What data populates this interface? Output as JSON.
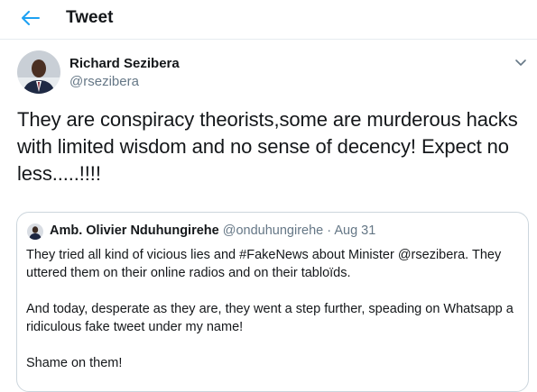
{
  "header": {
    "title": "Tweet"
  },
  "tweet": {
    "author_name": "Richard Sezibera",
    "author_handle": "@rsezibera",
    "text": "They are conspiracy theorists,some are murderous hacks with limited wisdom and no sense of decency! Expect no less.....!!!!"
  },
  "quoted_tweet": {
    "author_name": "Amb. Olivier Nduhungirehe",
    "author_handle": "@onduhungirehe",
    "separator": "·",
    "date": "Aug 31",
    "paragraphs": [
      "They tried all kind of vicious lies and #FakeNews about Minister @rsezibera. They uttered them on their online radios and on their tabloïds.",
      "And today, desperate as they are, they went a step further, speading  on Whatsapp a ridiculous fake tweet under my name!",
      "Shame on them!"
    ]
  },
  "colors": {
    "accent": "#1da1f2",
    "secondary_text": "#657786",
    "border": "#e6ecf0"
  },
  "icons": {
    "back": "arrow-left-icon",
    "caret": "chevron-down-icon"
  }
}
